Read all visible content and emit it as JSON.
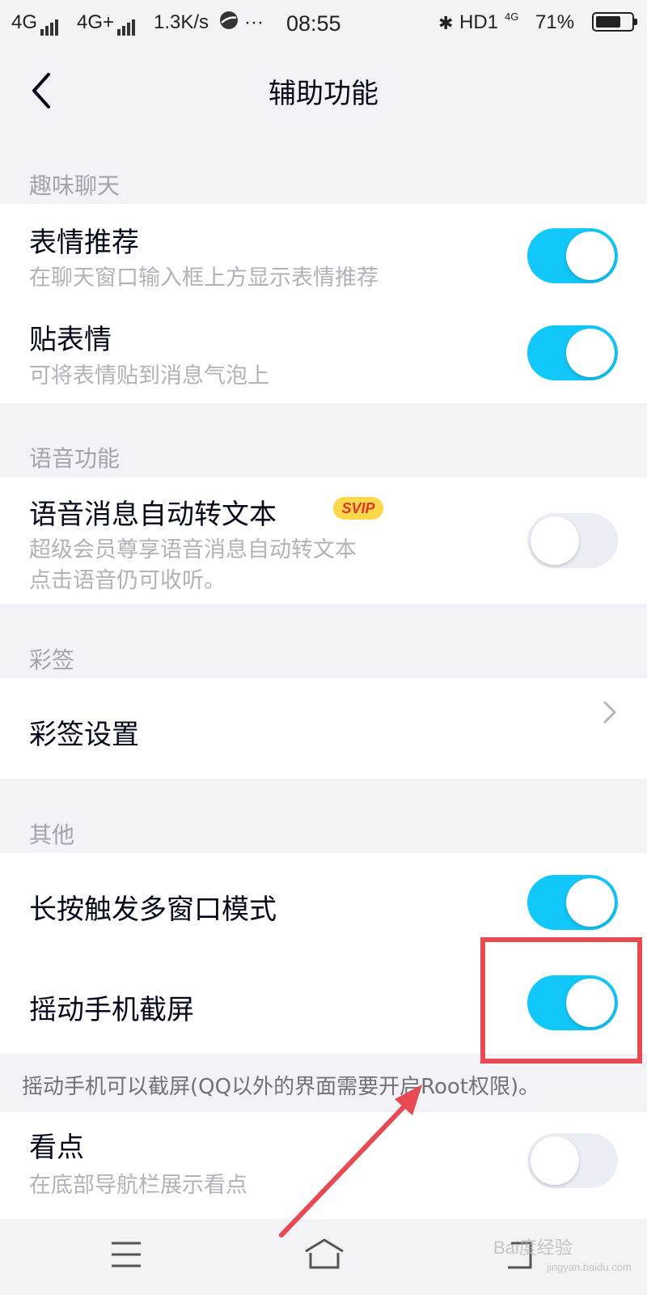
{
  "status_bar": {
    "signal_1": "4G",
    "signal_2": "4G+",
    "speed": "1.3K/s",
    "more": "···",
    "time": "08:55",
    "bluetooth": "✱",
    "hd": "HD1",
    "net_small": "4G",
    "battery_percent": "71%",
    "battery_level": 0.71
  },
  "header": {
    "title": "辅助功能",
    "back_icon": "chevron-left-icon"
  },
  "sections": {
    "fun_chat": {
      "header": "趣味聊天",
      "items": [
        {
          "title": "表情推荐",
          "desc": "在聊天窗口输入框上方显示表情推荐",
          "toggle": "on"
        },
        {
          "title": "贴表情",
          "desc": "可将表情贴到消息气泡上",
          "toggle": "on"
        }
      ]
    },
    "voice": {
      "header": "语音功能",
      "items": [
        {
          "title": "语音消息自动转文本",
          "badge": "SVIP",
          "desc_line1": "超级会员尊享语音消息自动转文本",
          "desc_line2": "点击语音仍可收听。",
          "toggle": "off"
        }
      ]
    },
    "caiqian": {
      "header": "彩签",
      "items": [
        {
          "title": "彩签设置",
          "icon": "chevron-right-icon"
        }
      ]
    },
    "other": {
      "header": "其他",
      "items": [
        {
          "title": "长按触发多窗口模式",
          "toggle": "on"
        },
        {
          "title": "摇动手机截屏",
          "toggle": "on"
        }
      ],
      "note": "摇动手机可以截屏(QQ以外的界面需要开启Root权限)。"
    },
    "kandian": {
      "items": [
        {
          "title": "看点",
          "desc": "在底部导航栏展示看点",
          "toggle": "off"
        }
      ]
    }
  },
  "bottom_bar": {
    "icons": [
      "menu-icon",
      "home-icon",
      "back-icon"
    ]
  },
  "watermark": {
    "text": "Bai度经验",
    "sub": "jingyan.baidu.com"
  },
  "colors": {
    "toggle_on": "#12c7fa",
    "toggle_off": "#eceef5",
    "annotation": "#e84a54",
    "badge_bg": "#ffd84a",
    "badge_text": "#e2362b"
  }
}
